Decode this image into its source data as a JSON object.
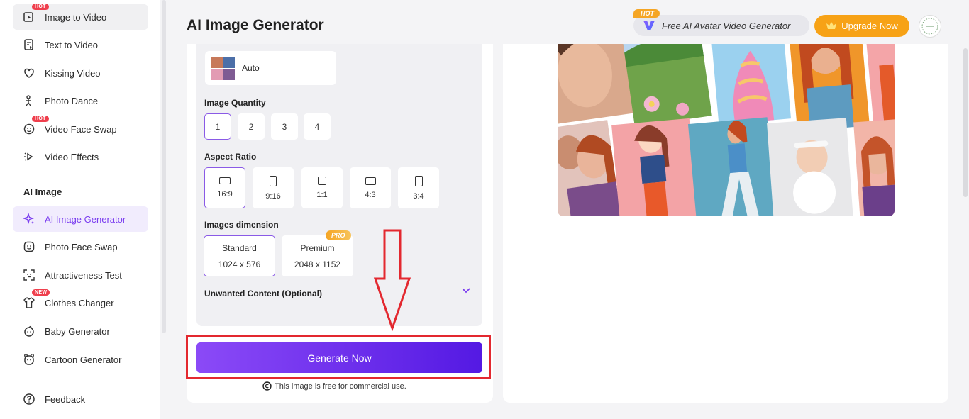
{
  "sidebar": {
    "items": [
      {
        "label": "Image to Video",
        "badge": "HOT"
      },
      {
        "label": "Text to Video"
      },
      {
        "label": "Kissing Video"
      },
      {
        "label": "Photo Dance"
      },
      {
        "label": "Video Face Swap",
        "badge": "HOT"
      },
      {
        "label": "Video Effects"
      }
    ],
    "section_title": "AI Image",
    "image_items": [
      {
        "label": "AI Image Generator"
      },
      {
        "label": "Photo Face Swap"
      },
      {
        "label": "Attractiveness Test"
      },
      {
        "label": "Clothes Changer",
        "badge": "NEW"
      },
      {
        "label": "Baby Generator"
      },
      {
        "label": "Cartoon Generator"
      }
    ],
    "feedback": "Feedback"
  },
  "header": {
    "title": "AI Image Generator",
    "promo_tag": "HOT",
    "promo_text": "Free AI Avatar Video Generator",
    "upgrade_label": "Upgrade Now"
  },
  "settings": {
    "model_value": "Auto",
    "quantity_label": "Image Quantity",
    "quantities": [
      "1",
      "2",
      "3",
      "4"
    ],
    "quantity_selected": "1",
    "ratio_label": "Aspect Ratio",
    "ratios": [
      "16:9",
      "9:16",
      "1:1",
      "4:3",
      "3:4"
    ],
    "ratio_selected": "16:9",
    "dimension_label": "Images dimension",
    "dimensions": [
      {
        "name": "Standard",
        "size": "1024 x 576"
      },
      {
        "name": "Premium",
        "size": "2048 x 1152",
        "tag": "PRO"
      }
    ],
    "unwanted_label": "Unwanted Content (Optional)",
    "generate_label": "Generate Now",
    "commercial_note": "This image is free for commercial use."
  },
  "colors": {
    "accent": "#7a3cf0",
    "upgrade": "#f7a216",
    "annotation": "#e3282f"
  }
}
